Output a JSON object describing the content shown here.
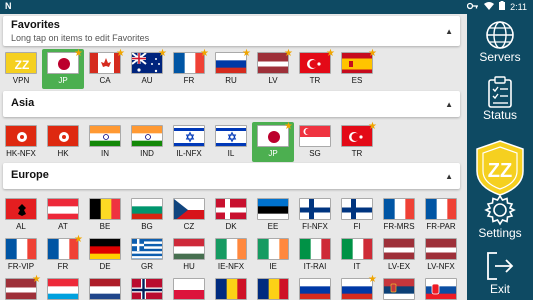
{
  "status_bar": {
    "left": "N",
    "time": "2:11"
  },
  "favorites": {
    "title": "Favorites",
    "subtitle": "Long tap on items to edit Favorites",
    "items": [
      {
        "code": "VPN",
        "flag": "vpn",
        "star": false,
        "selected": false
      },
      {
        "code": "JP",
        "flag": "JP",
        "star": true,
        "selected": true
      },
      {
        "code": "CA",
        "flag": "CA",
        "star": true,
        "selected": false
      },
      {
        "code": "AU",
        "flag": "AU",
        "star": true,
        "selected": false
      },
      {
        "code": "FR",
        "flag": "FR",
        "star": true,
        "selected": false
      },
      {
        "code": "RU",
        "flag": "RU",
        "star": true,
        "selected": false
      },
      {
        "code": "LV",
        "flag": "LV",
        "star": true,
        "selected": false
      },
      {
        "code": "TR",
        "flag": "TR",
        "star": true,
        "selected": false
      },
      {
        "code": "ES",
        "flag": "ES",
        "star": true,
        "selected": false
      }
    ]
  },
  "asia": {
    "title": "Asia",
    "items": [
      {
        "code": "HK-NFX",
        "flag": "HK",
        "star": false,
        "selected": false
      },
      {
        "code": "HK",
        "flag": "HK",
        "star": false,
        "selected": false
      },
      {
        "code": "IN",
        "flag": "IN",
        "star": false,
        "selected": false
      },
      {
        "code": "IND",
        "flag": "IN",
        "star": false,
        "selected": false
      },
      {
        "code": "IL-NFX",
        "flag": "IL",
        "star": false,
        "selected": false
      },
      {
        "code": "IL",
        "flag": "IL",
        "star": false,
        "selected": false
      },
      {
        "code": "JP",
        "flag": "JP",
        "star": true,
        "selected": true
      },
      {
        "code": "SG",
        "flag": "SG",
        "star": false,
        "selected": false
      },
      {
        "code": "TR",
        "flag": "TR",
        "star": true,
        "selected": false
      }
    ]
  },
  "europe": {
    "title": "Europe",
    "rows": [
      [
        {
          "code": "AL",
          "flag": "AL",
          "star": false
        },
        {
          "code": "AT",
          "flag": "AT",
          "star": false
        },
        {
          "code": "BE",
          "flag": "BE",
          "star": false
        },
        {
          "code": "BG",
          "flag": "BG",
          "star": false
        },
        {
          "code": "CZ",
          "flag": "CZ",
          "star": false
        },
        {
          "code": "DK",
          "flag": "DK",
          "star": false
        },
        {
          "code": "EE",
          "flag": "EE",
          "star": false
        },
        {
          "code": "FI-NFX",
          "flag": "FI",
          "star": false
        },
        {
          "code": "FI",
          "flag": "FI",
          "star": false
        },
        {
          "code": "FR-MRS",
          "flag": "FR",
          "star": false
        },
        {
          "code": "FR-PAR",
          "flag": "FR",
          "star": false
        }
      ],
      [
        {
          "code": "FR-VIP",
          "flag": "FR",
          "star": false
        },
        {
          "code": "FR",
          "flag": "FR",
          "star": true
        },
        {
          "code": "DE",
          "flag": "DE",
          "star": false
        },
        {
          "code": "GR",
          "flag": "GR",
          "star": false
        },
        {
          "code": "HU",
          "flag": "HU",
          "star": false
        },
        {
          "code": "IE-NFX",
          "flag": "IE",
          "star": false
        },
        {
          "code": "IE",
          "flag": "IE",
          "star": false
        },
        {
          "code": "IT-RAI",
          "flag": "IT",
          "star": false
        },
        {
          "code": "IT",
          "flag": "IT",
          "star": false
        },
        {
          "code": "LV-EX",
          "flag": "LV",
          "star": false
        },
        {
          "code": "LV-NFX",
          "flag": "LV",
          "star": false
        }
      ],
      [
        {
          "code": "",
          "flag": "LV",
          "star": true
        },
        {
          "code": "",
          "flag": "LU",
          "star": false
        },
        {
          "code": "",
          "flag": "NL",
          "star": false
        },
        {
          "code": "",
          "flag": "NO",
          "star": false
        },
        {
          "code": "",
          "flag": "PL",
          "star": false
        },
        {
          "code": "",
          "flag": "RO",
          "star": false
        },
        {
          "code": "",
          "flag": "RO",
          "star": false
        },
        {
          "code": "",
          "flag": "RU",
          "star": false
        },
        {
          "code": "",
          "flag": "RU",
          "star": true
        },
        {
          "code": "",
          "flag": "RS",
          "star": false
        },
        {
          "code": "",
          "flag": "SK",
          "star": false
        }
      ]
    ]
  },
  "sidebar": {
    "servers_label": "Servers",
    "status_label": "Status",
    "settings_label": "Settings",
    "exit_label": "Exit",
    "logo_text": "ZZ"
  },
  "colors": {
    "sidebar_bg": "#0e4a63",
    "selected_bg": "#4caf50",
    "star": "#f0a500"
  }
}
